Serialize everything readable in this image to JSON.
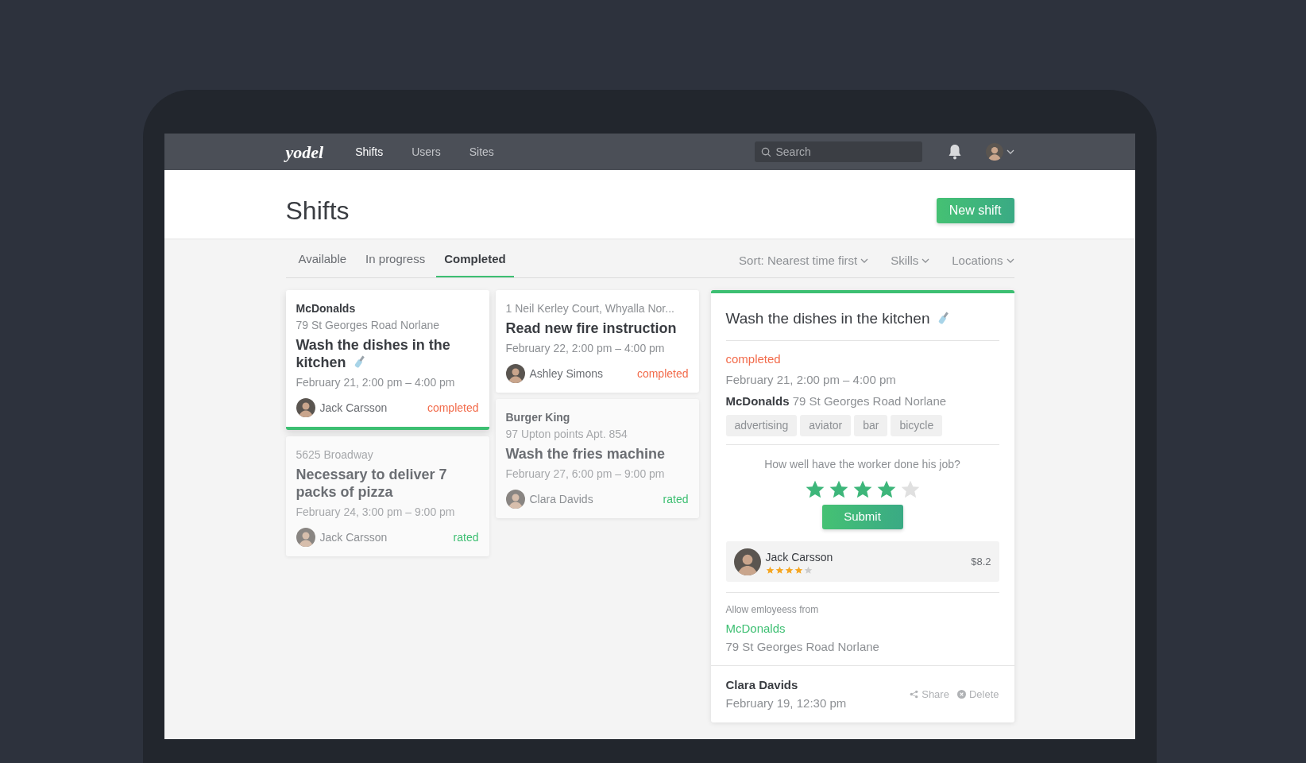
{
  "nav": {
    "logo": "yodel",
    "items": [
      {
        "label": "Shifts",
        "selected": true
      },
      {
        "label": "Users",
        "selected": false
      },
      {
        "label": "Sites",
        "selected": false
      }
    ],
    "search": {
      "placeholder": "Search"
    }
  },
  "header": {
    "title": "Shifts",
    "button": "New shift"
  },
  "tabs": [
    {
      "label": "Available",
      "selected": false
    },
    {
      "label": "In progress",
      "selected": false
    },
    {
      "label": "Completed",
      "selected": true
    }
  ],
  "filters": [
    "Sort: Nearest time first",
    "Skills",
    "Locations"
  ],
  "columns": [
    [
      {
        "company": "McDonalds",
        "address": "79 St Georges Road Norlane",
        "title": "Wash the dishes in the kitchen",
        "brush_icon": true,
        "time": "February 21, 2:00 pm – 4:00 pm",
        "worker": "Jack Carsson",
        "status": {
          "kind": "completed",
          "label": "completed"
        },
        "selected": true,
        "dimmed": false
      },
      {
        "address": "5625 Broadway",
        "title": "Necessary to deliver 7 packs of pizza",
        "brush_icon": false,
        "time": "February 24, 3:00 pm – 9:00 pm",
        "worker": "Jack Carsson",
        "status": {
          "kind": "rated",
          "label": "rated"
        },
        "selected": false,
        "dimmed": true
      }
    ],
    [
      {
        "address": "1 Neil Kerley Court, Whyalla Nor...",
        "title": "Read new fire instruction",
        "brush_icon": false,
        "time": "February 22, 2:00 pm – 4:00 pm",
        "worker": "Ashley Simons",
        "status": {
          "kind": "completed",
          "label": "completed"
        },
        "selected": false,
        "dimmed": false
      },
      {
        "company": "Burger King",
        "address": "97 Upton points Apt. 854",
        "title": "Wash the fries machine",
        "brush_icon": false,
        "time": "February 27, 6:00 pm – 9:00 pm",
        "worker": "Clara Davids",
        "status": {
          "kind": "rated",
          "label": "rated"
        },
        "selected": false,
        "dimmed": true
      }
    ]
  ],
  "detail": {
    "title": "Wash the dishes in the kitchen",
    "brush_icon": true,
    "status": {
      "kind": "completed",
      "label": "completed"
    },
    "time": "February 21, 2:00 pm – 4:00 pm",
    "company": "McDonalds",
    "address": "79 St Georges Road Norlane",
    "tags": [
      "advertising",
      "aviator",
      "bar",
      "bicycle"
    ],
    "question": "How well have the worker done his job?",
    "rating": {
      "stars": 4
    },
    "submit": "Submit",
    "worker": {
      "name": "Jack Carsson",
      "stars": 4,
      "pay": "$8.2"
    },
    "allow_label": "Allow emloyeess from",
    "allow_company": "McDonalds",
    "allow_address": "79 St Georges Road Norlane",
    "footer": {
      "name": "Clara Davids",
      "time": "February 19, 12:30 pm",
      "actions": [
        {
          "kind": "share",
          "label": "Share"
        },
        {
          "kind": "delete",
          "label": "Delete"
        }
      ]
    }
  }
}
